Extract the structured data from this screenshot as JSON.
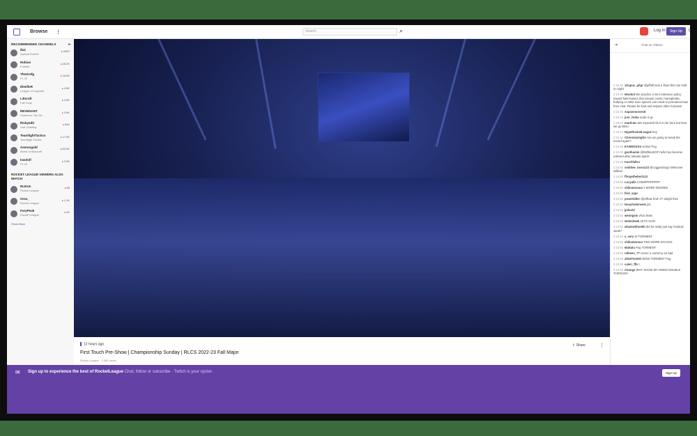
{
  "colors": {
    "brand": "#6441a5",
    "accent": "#5b4fa8",
    "live": "#e91916",
    "background": "#3b6b3d"
  },
  "topbar": {
    "browse_label": "Browse",
    "more_icon": "more-vertical-icon",
    "search_placeholder": "Search",
    "search_icon": "search-icon",
    "notification_count": "",
    "login_label": "Log In",
    "signup_label": "Sign Up",
    "user_icon": "user-icon"
  },
  "sidebar": {
    "recommended_header": "RECOMMENDED CHANNELS",
    "collapse_icon": "collapse-left-icon",
    "channels": [
      {
        "name": "ibai",
        "game": "Special Events",
        "viewers": "262K"
      },
      {
        "name": "Rubius",
        "game": "Fortnite",
        "viewers": "26.2K"
      },
      {
        "name": "TheGrefg",
        "game": "F1 22",
        "viewers": "16.5K"
      },
      {
        "name": "ElmilloR",
        "game": "League of Legends",
        "viewers": "4.5K"
      },
      {
        "name": "L3tcraft",
        "game": "Fall Guys",
        "viewers": "4.0K"
      },
      {
        "name": "REVENANT",
        "game": "Pokémon: Tai Chi...",
        "viewers": "3.5K"
      },
      {
        "name": "Rickyedit",
        "game": "Just Chatting",
        "viewers": "64K"
      },
      {
        "name": "TeamfightTactics",
        "game": "Teamfight Tactics",
        "viewers": "17.9K"
      },
      {
        "name": "Asmongold",
        "game": "World of Warcraft",
        "viewers": "50.5K"
      },
      {
        "name": "Ivanlolf",
        "game": "F1 22",
        "viewers": "3.9K"
      }
    ],
    "also_watch_header": "ROCKET LEAGUE VIEWERS ALSO WATCH",
    "also_watch": [
      {
        "name": "RLEsm",
        "game": "Rocket League",
        "viewers": "85"
      },
      {
        "name": "Oreu_",
        "game": "Rocket League",
        "viewers": "1.1K"
      },
      {
        "name": "FuryPeak",
        "game": "Rocket League",
        "viewers": "2K"
      }
    ],
    "show_more": "Show More"
  },
  "stream": {
    "time_ago": "12 hours ago",
    "title": "First Touch Pre-Show | Championship Sunday | RLCS 2022-23 Fall Major",
    "meta": "Rocket League · 2,080 views",
    "share_label": "Share",
    "share_icon": "share-icon",
    "more_icon": "more-vertical-icon"
  },
  "chat": {
    "title": "Chat on Videos",
    "collapse_icon": "collapse-right-icon",
    "messages": [
      {
        "time": "2:15:45",
        "user": "@lupus_pilgr",
        "text": "@jeffalt look a flood this can hold on eight"
      },
      {
        "time": "2:15:49",
        "user": "Moobot",
        "text": "We practice a zero tolerance policy toward hate-based chat (Sexist, racist, homophobic, bullying or other toxic speech can result in permanent ban from chat. Please be kind and respect other humans!"
      },
      {
        "time": "2:15:45",
        "user": "supasmoove18",
        "text": ""
      },
      {
        "time": "2:15:43",
        "user": "just_Onbu",
        "text": "scale it up"
      },
      {
        "time": "2:15:43",
        "user": "martinec",
        "text": "We expected OLG to be here but here we go Ekso"
      },
      {
        "time": "2:15:44",
        "user": "HypeRocketLeague",
        "text": "hey"
      },
      {
        "time": "2:15:44",
        "user": "Chnnotavingfor",
        "text": "Are we going to break the record again?"
      },
      {
        "time": "2:15:45",
        "user": "EYWHOSSS",
        "text": "Hello!! Pog"
      },
      {
        "time": "2:15:45",
        "user": "gouthamm",
        "text": "@RefBoxSOF hello hey become relevant after toleado speck"
      },
      {
        "time": "2:15:45",
        "user": "touchfallsx",
        "text": ""
      },
      {
        "time": "2:15:50",
        "user": "smithee_boss123",
        "text": "@coggerdongo Welcome wildcat"
      },
      {
        "time": "2:15:50",
        "user": "fforgethebert123",
        "text": ""
      },
      {
        "time": "2:15:50",
        "user": "Lucyalls",
        "text": "CHIMPPPPPPPP"
      },
      {
        "time": "2:15:50",
        "user": "shikamaruuu",
        "text": "2 MORE DEGREE"
      },
      {
        "time": "2:15:50",
        "user": "find_sppr",
        "text": ""
      },
      {
        "time": "2:15:52",
        "user": "powerkiller",
        "text": "@jeffratz bruh !!? alright then"
      },
      {
        "time": "2:15:52",
        "user": "NosyOwlsnsels",
        "text": "pl1"
      },
      {
        "time": "2:15:52",
        "user": "jpdavid",
        "text": ""
      },
      {
        "time": "2:15:53",
        "user": "wenngsts",
        "text": "vh1e.feats"
      },
      {
        "time": "2:15:53",
        "user": "wtsbcbeek",
        "text": "LETS GOO"
      },
      {
        "time": "2:15:53",
        "user": "whatzwithsebb",
        "text": "did he really just say medical weak?"
      },
      {
        "time": "2:15:54",
        "user": "a_very",
        "text": "W TORMENT"
      },
      {
        "time": "2:15:55",
        "user": "shikamaruuu",
        "text": "TWO MORE DAYSSS"
      },
      {
        "time": "2:15:55",
        "user": "Mattatu",
        "text": "Pog TORMENT"
      },
      {
        "time": "2:15:55",
        "user": "relbeen_77",
        "text": "corner a currency so bad"
      },
      {
        "time": "2:15:55",
        "user": "allsetTom00",
        "text": "WOW TORMENT Pog"
      },
      {
        "time": "2:15:56",
        "user": "caleri_fftc",
        "text": "!"
      },
      {
        "time": "2:15:56",
        "user": "ctrungs",
        "text": "WHY SHOW MY OWNS DOUBLE THROUGH"
      }
    ]
  },
  "banner": {
    "icon": "twitch-glitch-icon",
    "text_bold": "Sign up to experience the best of RocketLeague",
    "text_rest": "Chat, follow or subscribe - Twitch is your oyster.",
    "button_label": "Sign Up"
  }
}
